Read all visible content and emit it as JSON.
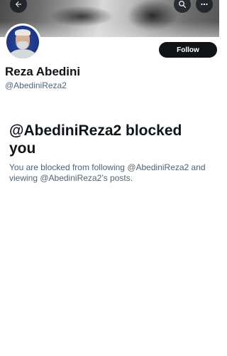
{
  "header": {
    "back_icon": "arrow-left-icon",
    "search_icon": "search-icon",
    "more_icon": "more-horizontal-icon"
  },
  "profile": {
    "display_name": "Reza Abedini",
    "handle": "@AbediniReza2",
    "follow_label": "Follow"
  },
  "blocked": {
    "title": "@AbediniReza2 blocked you",
    "description": "You are blocked from following @AbediniReza2 and viewing @AbediniReza2’s posts."
  },
  "colors": {
    "primary_text": "#0f1419",
    "secondary_text": "#536471",
    "follow_bg": "#0f1419",
    "avatar_bg": "#1f3a8a"
  }
}
